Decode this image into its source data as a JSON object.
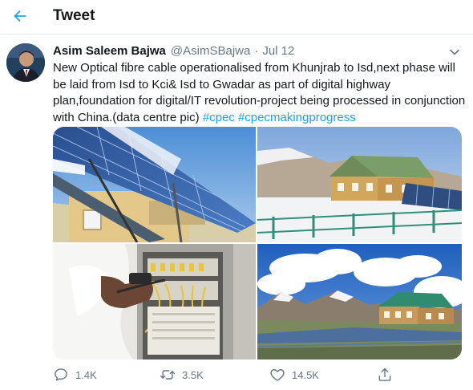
{
  "header": {
    "title": "Tweet",
    "back_icon": "arrow-left-icon"
  },
  "colors": {
    "accent": "#1da1f2",
    "text": "#14171a",
    "muted": "#657786",
    "divider": "#e6ecf0"
  },
  "tweet": {
    "author_name": "Asim Saleem Bajwa",
    "author_handle": "@AsimSBajwa",
    "separator": "·",
    "date": "Jul 12",
    "text": "New Optical fibre cable operationalised from Khunjrab to Isd,next phase will be laid from Isd to Kci& Isd to Gwadar as part of digital highway plan,foundation for digital/IT revolution-project being processed in conjunction with China.(data centre pic)",
    "hashtags": [
      "#cpec",
      "#cpecmakingprogress"
    ],
    "media": [
      {
        "icon": "solar-panels-photo"
      },
      {
        "icon": "mountain-building-photo"
      },
      {
        "icon": "fibre-rack-photo"
      },
      {
        "icon": "mountain-clouds-photo"
      }
    ],
    "actions": {
      "reply": {
        "icon": "reply-icon",
        "count": "1.4K"
      },
      "retweet": {
        "icon": "retweet-icon",
        "count": "3.5K"
      },
      "like": {
        "icon": "heart-icon",
        "count": "14.5K"
      },
      "share": {
        "icon": "share-icon"
      }
    }
  }
}
